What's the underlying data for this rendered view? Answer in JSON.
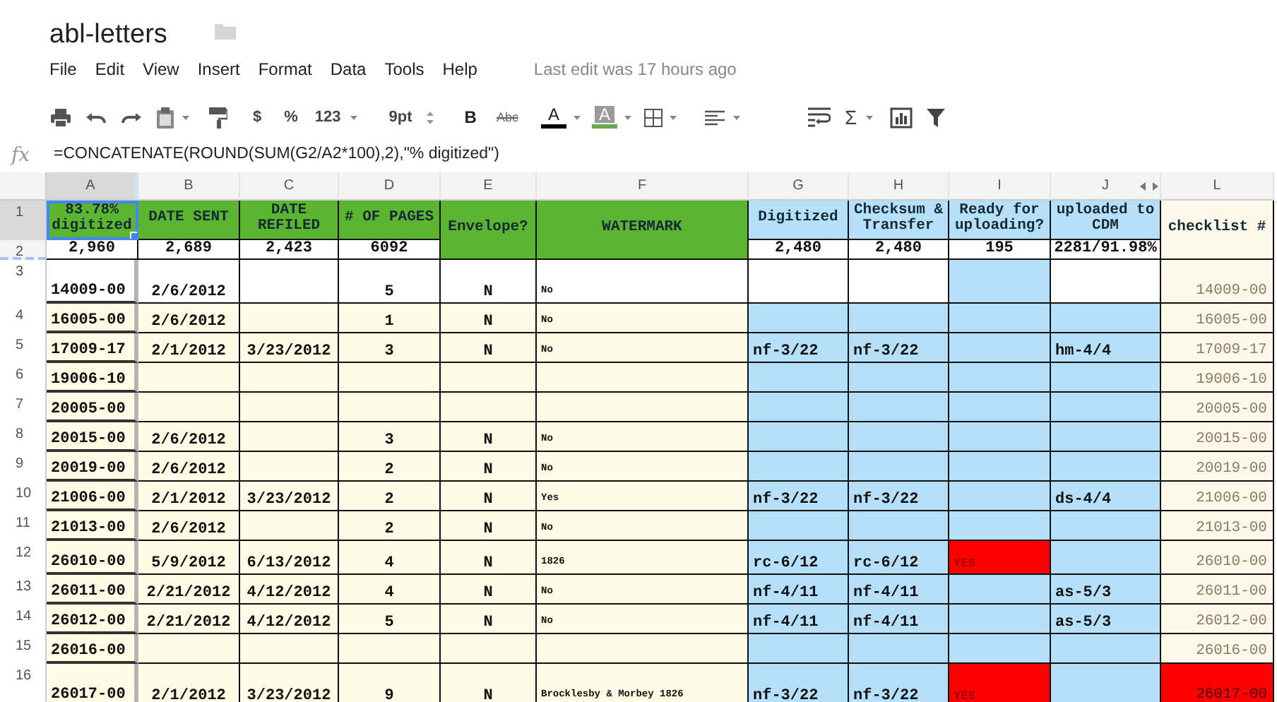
{
  "document": {
    "title": "abl-letters",
    "last_edit": "Last edit was 17 hours ago"
  },
  "menu": [
    "File",
    "Edit",
    "View",
    "Insert",
    "Format",
    "Data",
    "Tools",
    "Help"
  ],
  "toolbar": {
    "currency": "$",
    "percent": "%",
    "number_format": "123",
    "font_size": "9pt",
    "bold": "B",
    "strikethrough": "Abc",
    "text_color": {
      "label": "A",
      "color": "#000000"
    },
    "fill_color": {
      "label": "A",
      "color": "#6aa84f"
    },
    "sum": "Σ"
  },
  "formula_bar": {
    "label": "fx",
    "formula": "=CONCATENATE(ROUND(SUM(G2/A2*100),2),\"% digitized\")"
  },
  "sheet": {
    "columns": [
      {
        "letter": "A",
        "selected": true
      },
      {
        "letter": "B",
        "selected": false
      },
      {
        "letter": "C",
        "selected": false
      },
      {
        "letter": "D",
        "selected": false
      },
      {
        "letter": "E",
        "selected": false
      },
      {
        "letter": "F",
        "selected": false
      },
      {
        "letter": "G",
        "selected": false
      },
      {
        "letter": "H",
        "selected": false
      },
      {
        "letter": "I",
        "selected": false
      },
      {
        "letter": "J",
        "selected": false
      },
      {
        "letter": "L",
        "selected": false
      }
    ],
    "rows": [
      {
        "number": "1",
        "selected": true,
        "cells": [
          {
            "text": "83.78% digitized",
            "color": "#5cb531"
          },
          {
            "text": "DATE SENT",
            "color": "#5cb531"
          },
          {
            "text": "DATE REFILED",
            "color": "#5cb531"
          },
          {
            "text": "# OF PAGES",
            "color": "#5cb531"
          },
          {
            "text": "Envelope?",
            "color": "#5cb531",
            "merged_down": true
          },
          {
            "text": "WATERMARK",
            "color": "#5cb531",
            "merged_down": true
          },
          {
            "text": "Digitized",
            "color": "#b6e0f9"
          },
          {
            "text": "Checksum & Transfer",
            "color": "#b6e0f9"
          },
          {
            "text": "Ready for uploading?",
            "color": "#b6e0f9"
          },
          {
            "text": "uploaded to CDM",
            "color": "#b6e0f9"
          },
          {
            "text": "checklist #",
            "color": "#fdf8ea",
            "merged_down": true
          }
        ]
      },
      {
        "number": "2",
        "selected": false,
        "cells": [
          {
            "text": "2,960",
            "color": "#ffffff"
          },
          {
            "text": "2,689",
            "color": "#ffffff"
          },
          {
            "text": "2,423",
            "color": "#ffffff"
          },
          {
            "text": "6092",
            "color": "#ffffff"
          },
          {
            "text": ""
          },
          {
            "text": ""
          },
          {
            "text": "2,480",
            "color": "#ffffff"
          },
          {
            "text": "2,480",
            "color": "#ffffff"
          },
          {
            "text": "195",
            "color": "#ffffff"
          },
          {
            "text": "2281/91.98%",
            "color": "#ffffff"
          },
          {
            "text": ""
          }
        ]
      },
      {
        "number": "3",
        "selected": false,
        "cells": [
          {
            "text": "14009-00",
            "color": "#ffffff"
          },
          {
            "text": "2/6/2012",
            "color": "#ffffff"
          },
          {
            "color": "#ffffff"
          },
          {
            "text": "5",
            "color": "#ffffff"
          },
          {
            "text": "N",
            "color": "#ffffff"
          },
          {
            "text": "No",
            "color": "#ffffff"
          },
          {
            "color": "#ffffff"
          },
          {
            "color": "#ffffff"
          },
          {
            "color": "#b6e0f9"
          },
          {
            "color": "#ffffff"
          },
          {
            "text": "14009-00",
            "color": "#fdf8ea"
          }
        ]
      },
      {
        "number": "4",
        "selected": false,
        "cells": [
          {
            "text": "16005-00",
            "color": "#fffbe5"
          },
          {
            "text": "2/6/2012",
            "color": "#fffbe5"
          },
          {
            "color": "#fffbe5"
          },
          {
            "text": "1",
            "color": "#fffbe5"
          },
          {
            "text": "N",
            "color": "#fffbe5"
          },
          {
            "text": "No",
            "color": "#fffbe5"
          },
          {
            "color": "#b6e0f9"
          },
          {
            "color": "#b6e0f9"
          },
          {
            "color": "#b6e0f9"
          },
          {
            "color": "#b6e0f9"
          },
          {
            "text": "16005-00",
            "color": "#fdf8ea"
          }
        ]
      },
      {
        "number": "5",
        "selected": false,
        "cells": [
          {
            "text": "17009-17",
            "color": "#fffbe5"
          },
          {
            "text": "2/1/2012",
            "color": "#fffbe5"
          },
          {
            "text": "3/23/2012",
            "color": "#fffbe5"
          },
          {
            "text": "3",
            "color": "#fffbe5"
          },
          {
            "text": "N",
            "color": "#fffbe5"
          },
          {
            "text": "No",
            "color": "#fffbe5"
          },
          {
            "text": "nf-3/22",
            "color": "#b6e0f9"
          },
          {
            "text": "nf-3/22",
            "color": "#b6e0f9"
          },
          {
            "color": "#b6e0f9"
          },
          {
            "text": "hm-4/4",
            "color": "#b6e0f9"
          },
          {
            "text": "17009-17",
            "color": "#fdf8ea"
          }
        ]
      },
      {
        "number": "6",
        "selected": false,
        "cells": [
          {
            "text": "19006-10",
            "color": "#fffbe5"
          },
          {
            "color": "#fffbe5"
          },
          {
            "color": "#fffbe5"
          },
          {
            "color": "#fffbe5"
          },
          {
            "color": "#fffbe5"
          },
          {
            "color": "#fffbe5"
          },
          {
            "color": "#b6e0f9"
          },
          {
            "color": "#b6e0f9"
          },
          {
            "color": "#b6e0f9"
          },
          {
            "color": "#b6e0f9"
          },
          {
            "text": "19006-10",
            "color": "#fdf8ea"
          }
        ]
      },
      {
        "number": "7",
        "selected": false,
        "cells": [
          {
            "text": "20005-00",
            "color": "#fffbe5"
          },
          {
            "color": "#fffbe5"
          },
          {
            "color": "#fffbe5"
          },
          {
            "color": "#fffbe5"
          },
          {
            "color": "#fffbe5"
          },
          {
            "color": "#fffbe5"
          },
          {
            "color": "#b6e0f9"
          },
          {
            "color": "#b6e0f9"
          },
          {
            "color": "#b6e0f9"
          },
          {
            "color": "#b6e0f9"
          },
          {
            "text": "20005-00",
            "color": "#fdf8ea"
          }
        ]
      },
      {
        "number": "8",
        "selected": false,
        "cells": [
          {
            "text": "20015-00",
            "color": "#fffbe5"
          },
          {
            "text": "2/6/2012",
            "color": "#fffbe5"
          },
          {
            "color": "#fffbe5"
          },
          {
            "text": "3",
            "color": "#fffbe5"
          },
          {
            "text": "N",
            "color": "#fffbe5"
          },
          {
            "text": "No",
            "color": "#fffbe5"
          },
          {
            "color": "#b6e0f9"
          },
          {
            "color": "#b6e0f9"
          },
          {
            "color": "#b6e0f9"
          },
          {
            "color": "#b6e0f9"
          },
          {
            "text": "20015-00",
            "color": "#fdf8ea"
          }
        ]
      },
      {
        "number": "9",
        "selected": false,
        "cells": [
          {
            "text": "20019-00",
            "color": "#fffbe5"
          },
          {
            "text": "2/6/2012",
            "color": "#fffbe5"
          },
          {
            "color": "#fffbe5"
          },
          {
            "text": "2",
            "color": "#fffbe5"
          },
          {
            "text": "N",
            "color": "#fffbe5"
          },
          {
            "text": "No",
            "color": "#fffbe5"
          },
          {
            "color": "#b6e0f9"
          },
          {
            "color": "#b6e0f9"
          },
          {
            "color": "#b6e0f9"
          },
          {
            "color": "#b6e0f9"
          },
          {
            "text": "20019-00",
            "color": "#fdf8ea"
          }
        ]
      },
      {
        "number": "10",
        "selected": false,
        "cells": [
          {
            "text": "21006-00",
            "color": "#fffbe5"
          },
          {
            "text": "2/1/2012",
            "color": "#fffbe5"
          },
          {
            "text": "3/23/2012",
            "color": "#fffbe5"
          },
          {
            "text": "2",
            "color": "#fffbe5"
          },
          {
            "text": "N",
            "color": "#fffbe5"
          },
          {
            "text": "Yes",
            "color": "#fffbe5"
          },
          {
            "text": "nf-3/22",
            "color": "#b6e0f9"
          },
          {
            "text": "nf-3/22",
            "color": "#b6e0f9"
          },
          {
            "color": "#b6e0f9"
          },
          {
            "text": "ds-4/4",
            "color": "#b6e0f9"
          },
          {
            "text": "21006-00",
            "color": "#fdf8ea"
          }
        ]
      },
      {
        "number": "11",
        "selected": false,
        "cells": [
          {
            "text": "21013-00",
            "color": "#fffbe5"
          },
          {
            "text": "2/6/2012",
            "color": "#fffbe5"
          },
          {
            "color": "#fffbe5"
          },
          {
            "text": "2",
            "color": "#fffbe5"
          },
          {
            "text": "N",
            "color": "#fffbe5"
          },
          {
            "text": "No",
            "color": "#fffbe5"
          },
          {
            "color": "#b6e0f9"
          },
          {
            "color": "#b6e0f9"
          },
          {
            "color": "#b6e0f9"
          },
          {
            "color": "#b6e0f9"
          },
          {
            "text": "21013-00",
            "color": "#fdf8ea"
          }
        ]
      },
      {
        "number": "12",
        "selected": false,
        "cells": [
          {
            "text": "26010-00",
            "color": "#fffbe5"
          },
          {
            "text": "5/9/2012",
            "color": "#fffbe5"
          },
          {
            "text": "6/13/2012",
            "color": "#fffbe5"
          },
          {
            "text": "4",
            "color": "#fffbe5"
          },
          {
            "text": "N",
            "color": "#fffbe5"
          },
          {
            "text": "1826",
            "color": "#fffbe5"
          },
          {
            "text": "rc-6/12",
            "color": "#b6e0f9"
          },
          {
            "text": "rc-6/12",
            "color": "#b6e0f9"
          },
          {
            "text": "YES",
            "color": "#ff0000"
          },
          {
            "color": "#b6e0f9"
          },
          {
            "text": "26010-00",
            "color": "#fdf8ea"
          }
        ]
      },
      {
        "number": "13",
        "selected": false,
        "cells": [
          {
            "text": "26011-00",
            "color": "#fffbe5"
          },
          {
            "text": "2/21/2012",
            "color": "#fffbe5"
          },
          {
            "text": "4/12/2012",
            "color": "#fffbe5"
          },
          {
            "text": "4",
            "color": "#fffbe5"
          },
          {
            "text": "N",
            "color": "#fffbe5"
          },
          {
            "text": "No",
            "color": "#fffbe5"
          },
          {
            "text": "nf-4/11",
            "color": "#b6e0f9"
          },
          {
            "text": "nf-4/11",
            "color": "#b6e0f9"
          },
          {
            "color": "#b6e0f9"
          },
          {
            "text": "as-5/3",
            "color": "#b6e0f9"
          },
          {
            "text": "26011-00",
            "color": "#fdf8ea"
          }
        ]
      },
      {
        "number": "14",
        "selected": false,
        "cells": [
          {
            "text": "26012-00",
            "color": "#fffbe5"
          },
          {
            "text": "2/21/2012",
            "color": "#fffbe5"
          },
          {
            "text": "4/12/2012",
            "color": "#fffbe5"
          },
          {
            "text": "5",
            "color": "#fffbe5"
          },
          {
            "text": "N",
            "color": "#fffbe5"
          },
          {
            "text": "No",
            "color": "#fffbe5"
          },
          {
            "text": "nf-4/11",
            "color": "#b6e0f9"
          },
          {
            "text": "nf-4/11",
            "color": "#b6e0f9"
          },
          {
            "color": "#b6e0f9"
          },
          {
            "text": "as-5/3",
            "color": "#b6e0f9"
          },
          {
            "text": "26012-00",
            "color": "#fdf8ea"
          }
        ]
      },
      {
        "number": "15",
        "selected": false,
        "cells": [
          {
            "text": "26016-00",
            "color": "#fffbe5"
          },
          {
            "color": "#fffbe5"
          },
          {
            "color": "#fffbe5"
          },
          {
            "color": "#fffbe5"
          },
          {
            "color": "#fffbe5"
          },
          {
            "color": "#fffbe5"
          },
          {
            "color": "#b6e0f9"
          },
          {
            "color": "#b6e0f9"
          },
          {
            "color": "#b6e0f9"
          },
          {
            "color": "#b6e0f9"
          },
          {
            "text": "26016-00",
            "color": "#fdf8ea"
          }
        ]
      },
      {
        "number": "16",
        "selected": false,
        "cells": [
          {
            "text": "26017-00",
            "color": "#fffbe5"
          },
          {
            "text": "2/1/2012",
            "color": "#fffbe5"
          },
          {
            "text": "3/23/2012",
            "color": "#fffbe5"
          },
          {
            "text": "9",
            "color": "#fffbe5"
          },
          {
            "text": "N",
            "color": "#fffbe5"
          },
          {
            "text": "Brocklesby & Morbey 1826",
            "color": "#fffbe5"
          },
          {
            "text": "nf-3/22",
            "color": "#b6e0f9"
          },
          {
            "text": "nf-3/22",
            "color": "#b6e0f9"
          },
          {
            "text": "YES",
            "color": "#ff0000"
          },
          {
            "color": "#b6e0f9"
          },
          {
            "text": "26017-00",
            "color": "#ff0000"
          }
        ]
      }
    ]
  }
}
